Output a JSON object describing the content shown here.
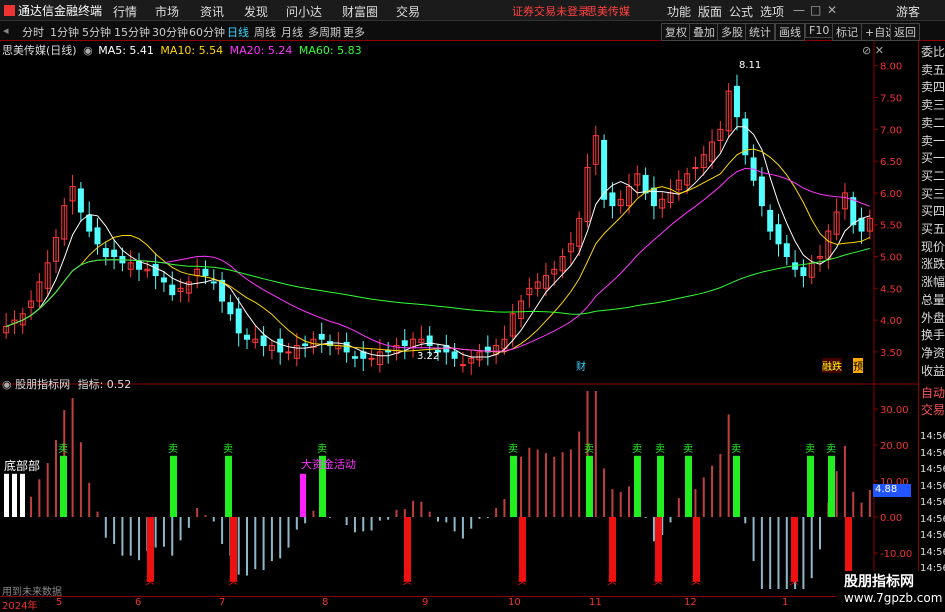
{
  "app": {
    "title": "通达信金融终端",
    "login_notice": "证券交易未登录",
    "stock_name_top": "思美传媒"
  },
  "menu": [
    "行情",
    "市场",
    "资讯",
    "发现",
    "问小达",
    "财富圈",
    "交易"
  ],
  "right_menu": [
    "功能",
    "版面",
    "公式",
    "选项",
    "游客"
  ],
  "periods": [
    "分时",
    "1分钟",
    "5分钟",
    "15分钟",
    "30分钟",
    "60分钟",
    "日线",
    "周线",
    "月线",
    "多周期",
    "更多"
  ],
  "active_period": "日线",
  "toolbar_right": [
    "复权",
    "叠加",
    "多股",
    "统计",
    "画线",
    "F10",
    "标记",
    "+自选",
    "返回"
  ],
  "main_chart": {
    "header": "思美传媒(日线)",
    "ma": [
      {
        "label": "MA5: 5.41",
        "color": "#ffffff"
      },
      {
        "label": "MA10: 5.54",
        "color": "#ffd700"
      },
      {
        "label": "MA20: 5.24",
        "color": "#ff33ff"
      },
      {
        "label": "MA60: 5.83",
        "color": "#33ff33"
      }
    ],
    "high_label": "8.11",
    "low_label": "3.22",
    "marker_cai": "财",
    "marker_tag": "融跌",
    "marker_yu": "预"
  },
  "indicator": {
    "header": "股朋指标网",
    "value_label": "指标: 0.52",
    "bottom_label": "底部部",
    "big_money_label": "大资金活动",
    "sell_label": "卖",
    "buy_label": "买",
    "hint": "用到未来数据",
    "current_value": "4.88"
  },
  "chart_data": [
    {
      "type": "candlestick",
      "title": "思美传媒(日线)",
      "y_ticks": [
        "8.00",
        "7.50",
        "7.00",
        "6.50",
        "6.00",
        "5.50",
        "5.00",
        "4.50",
        "4.00",
        "3.50"
      ],
      "ylim": [
        3.2,
        8.2
      ],
      "x_ticks": [
        "2024年",
        "5",
        "6",
        "7",
        "8",
        "9",
        "10",
        "11",
        "12",
        "1"
      ],
      "ohlc_close_approx": [
        3.9,
        4.0,
        4.1,
        4.3,
        4.6,
        4.9,
        5.3,
        5.8,
        6.1,
        5.7,
        5.4,
        5.2,
        5.0,
        5.0,
        4.9,
        4.9,
        4.8,
        4.8,
        4.7,
        4.6,
        4.4,
        4.5,
        4.6,
        4.8,
        4.7,
        4.6,
        4.3,
        4.1,
        3.8,
        3.7,
        3.7,
        3.6,
        3.6,
        3.5,
        3.5,
        3.6,
        3.6,
        3.7,
        3.7,
        3.6,
        3.6,
        3.5,
        3.4,
        3.4,
        3.4,
        3.5,
        3.5,
        3.6,
        3.6,
        3.7,
        3.7,
        3.6,
        3.5,
        3.5,
        3.4,
        3.3,
        3.4,
        3.5,
        3.5,
        3.6,
        3.7,
        4.1,
        4.3,
        4.5,
        4.6,
        4.7,
        4.8,
        5.0,
        5.2,
        5.6,
        6.4,
        6.9,
        5.9,
        5.8,
        5.9,
        6.1,
        6.3,
        6.0,
        5.8,
        5.9,
        6.0,
        6.2,
        6.3,
        6.4,
        6.6,
        6.8,
        7.0,
        7.6,
        7.2,
        6.6,
        6.2,
        5.8,
        5.4,
        5.2,
        5.0,
        4.8,
        4.7,
        4.9,
        5.0,
        5.4,
        5.7,
        6.0,
        5.5,
        5.4,
        5.6
      ]
    },
    {
      "type": "bar",
      "title": "股朋指标网",
      "y_ticks": [
        "30.00",
        "20.00",
        "10.00",
        "0.00",
        "-10.00"
      ],
      "ylim": [
        -20,
        35
      ],
      "sell_marks": [
        "卖",
        "卖",
        "卖",
        "卖",
        "卖",
        "卖",
        "卖",
        "卖",
        "卖",
        "卖",
        "卖",
        "卖"
      ],
      "buy_marks": [
        "买",
        "买",
        "买",
        "买",
        "买",
        "买",
        "买",
        "买",
        "买",
        "买"
      ]
    }
  ],
  "right_panel": [
    "委比",
    "卖五",
    "卖四",
    "卖三",
    "卖二",
    "卖一",
    "买一",
    "买二",
    "买三",
    "买四",
    "买五",
    "现价",
    "涨跌",
    "涨幅",
    "总量",
    "外盘",
    "换手",
    "净资",
    "收益"
  ],
  "right_panel2": [
    "自动",
    "交易"
  ],
  "time_rows": [
    "14:56",
    "14:56",
    "14:56",
    "14:56",
    "14:56",
    "14:56",
    "14:56",
    "14:56",
    "14:56",
    "14:56"
  ],
  "watermark": {
    "line1": "股朋指标网",
    "line2": "www.7gpzb.com"
  }
}
